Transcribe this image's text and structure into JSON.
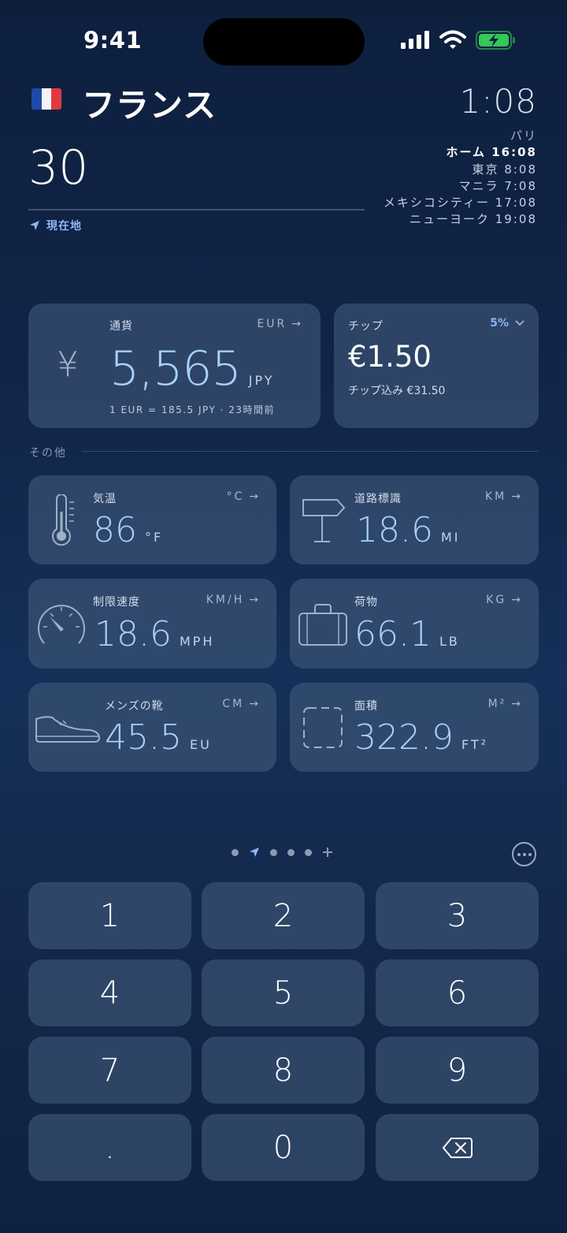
{
  "status": {
    "time": "9:41"
  },
  "header": {
    "country": "フランス",
    "input_value": "30",
    "location_label": "現在地",
    "local_time": "1:08",
    "clocks": [
      {
        "city": "パリ",
        "time": ""
      },
      {
        "city": "ホーム",
        "time": "16:08"
      },
      {
        "city": "東京",
        "time": "8:08"
      },
      {
        "city": "マニラ",
        "time": "7:08"
      },
      {
        "city": "メキシコシティー",
        "time": "17:08"
      },
      {
        "city": "ニューヨーク",
        "time": "19:08"
      }
    ]
  },
  "currency": {
    "label": "通貨",
    "from_unit": "EUR",
    "symbol": "¥",
    "value": "5,565",
    "to_unit": "JPY",
    "rate": "1 EUR = 185.5 JPY · 23時間前"
  },
  "tip": {
    "label": "チップ",
    "percent": "5%",
    "amount": "€1.50",
    "total": "チップ込み €31.50"
  },
  "section_other": "その他",
  "converters": [
    {
      "label": "気温",
      "switch": "°C",
      "value": "86",
      "unit": "°F"
    },
    {
      "label": "道路標識",
      "switch": "KM",
      "value": "18.6",
      "unit": "MI"
    },
    {
      "label": "制限速度",
      "switch": "KM/H",
      "value": "18.6",
      "unit": "MPH"
    },
    {
      "label": "荷物",
      "switch": "KG",
      "value": "66.1",
      "unit": "LB"
    },
    {
      "label": "メンズの靴",
      "switch": "CM",
      "value": "45.5",
      "unit": "EU"
    },
    {
      "label": "面積",
      "switch": "M²",
      "value": "322.9",
      "unit": "FT²"
    }
  ],
  "keypad": [
    "1",
    "2",
    "3",
    "4",
    "5",
    "6",
    "7",
    "8",
    "9",
    ".",
    "0"
  ],
  "colors": {
    "accent": "#a8d0ff",
    "link": "#8ab6f2",
    "battery": "#34c759"
  }
}
